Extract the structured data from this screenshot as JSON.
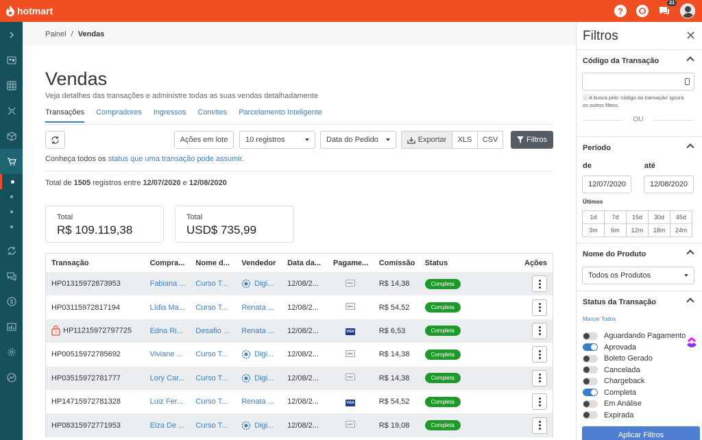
{
  "topbar": {
    "brand": "hotmart",
    "help_icon": "?",
    "notifications_count": "21"
  },
  "breadcrumb": {
    "parent": "Painel",
    "separator": "/",
    "current": "Vendas"
  },
  "page": {
    "title": "Vendas",
    "subtitle": "Veja detalhes das transações e administre todas as suas vendas detalhadamente"
  },
  "tabs": [
    {
      "label": "Transações",
      "active": true
    },
    {
      "label": "Compradores"
    },
    {
      "label": "Ingressos"
    },
    {
      "label": "Convites"
    },
    {
      "label": "Parcelamento Inteligente"
    }
  ],
  "toolbar": {
    "bulk_actions": "Ações em lote",
    "page_size": "10 registros",
    "date_field": "Data do Pedido",
    "export": "Exportar",
    "xls": "XLS",
    "csv": "CSV",
    "filters": "Filtros"
  },
  "info": {
    "prefix": "Conheça todos os",
    "link": "status que uma transação pode assumir",
    "suffix": "."
  },
  "totals_line": {
    "p1": "Total de",
    "count": "1505",
    "p2": "registros entre",
    "start": "12/07/2020",
    "p3": "e",
    "end": "12/08/2020"
  },
  "cards": [
    {
      "label": "Total",
      "value": "R$ 109.119,38"
    },
    {
      "label": "Total",
      "value": "USD$ 735,99"
    }
  ],
  "table": {
    "headers": [
      "Transação",
      "Compra...",
      "Nome d...",
      "Vendedor",
      "Data da...",
      "Pagame...",
      "Comissão",
      "Status",
      "Ações"
    ],
    "rows": [
      {
        "id": "HP01315972873953",
        "buyer": "Fabiana ...",
        "product": "Curso T...",
        "seller": "Digi...",
        "seller_icon": true,
        "date": "12/08/2...",
        "payment": "boleto",
        "commission": "R$ 14,38",
        "status": "Completa"
      },
      {
        "id": "HP03115972817194",
        "buyer": "Lídia Ma...",
        "product": "Curso T...",
        "seller": "Renata ...",
        "seller_icon": false,
        "date": "12/08/2...",
        "payment": "boleto",
        "commission": "R$ 54,52",
        "status": "Completa"
      },
      {
        "id": "HP11215972797725",
        "lock": true,
        "buyer": "Edna Ri...",
        "product": "Desafio ...",
        "seller": "Renata ...",
        "seller_icon": false,
        "date": "12/08/2...",
        "payment": "card",
        "commission": "R$ 6,53",
        "status": "Completa"
      },
      {
        "id": "HP00515972785692",
        "buyer": "Viviane ...",
        "product": "Curso T...",
        "seller": "Digi...",
        "seller_icon": true,
        "date": "12/08/2...",
        "payment": "boleto",
        "commission": "R$ 14,38",
        "status": "Completa"
      },
      {
        "id": "HP03515972781777",
        "buyer": "Lory Car...",
        "product": "Curso T...",
        "seller": "Digi...",
        "seller_icon": true,
        "date": "12/08/2...",
        "payment": "boleto",
        "commission": "R$ 14,38",
        "status": "Completa"
      },
      {
        "id": "HP14715972781328",
        "buyer": "Luiz Fer...",
        "product": "Curso T...",
        "seller": "Renata ...",
        "seller_icon": false,
        "date": "12/08/2...",
        "payment": "card",
        "commission": "R$ 54,52",
        "status": "Completa"
      },
      {
        "id": "HP08315972771953",
        "buyer": "Elza De ...",
        "product": "Curso T...",
        "seller": "Digi...",
        "seller_icon": true,
        "date": "12/08/2...",
        "payment": "boleto",
        "commission": "R$ 19,08",
        "status": "Completa"
      }
    ]
  },
  "filters": {
    "title": "Filtros",
    "close": "✕",
    "transaction_code": {
      "title": "Código da Transação",
      "hint": "A busca pelo 'código da transação' ignora os outros filtros.",
      "or": "OU"
    },
    "period": {
      "title": "Período",
      "from_label": "de",
      "to_label": "até",
      "from": "12/07/2020",
      "to": "12/08/2020",
      "last_label": "Últimos",
      "options": [
        "1d",
        "7d",
        "15d",
        "30d",
        "45d",
        "3m",
        "6m",
        "12m",
        "18m",
        "24m"
      ]
    },
    "product": {
      "title": "Nome do Produto",
      "value": "Todos os Produtos"
    },
    "status": {
      "title": "Status da Transação",
      "mark_all": "Marcar Todos",
      "items": [
        {
          "label": "Aguardando Pagamento",
          "on": false
        },
        {
          "label": "Aprovada",
          "on": true
        },
        {
          "label": "Boleto Gerado",
          "on": false
        },
        {
          "label": "Cancelada",
          "on": false
        },
        {
          "label": "Chargeback",
          "on": false
        },
        {
          "label": "Completa",
          "on": true
        },
        {
          "label": "Em Análise",
          "on": false
        },
        {
          "label": "Expirada",
          "on": false
        }
      ]
    },
    "apply": "Aplicar Filtros"
  },
  "colors": {
    "brand": "#f04e23",
    "sidebar": "#16505b",
    "link": "#3b7dc4",
    "status_complete": "#1f9a2a",
    "apply": "#4f7fd0"
  }
}
